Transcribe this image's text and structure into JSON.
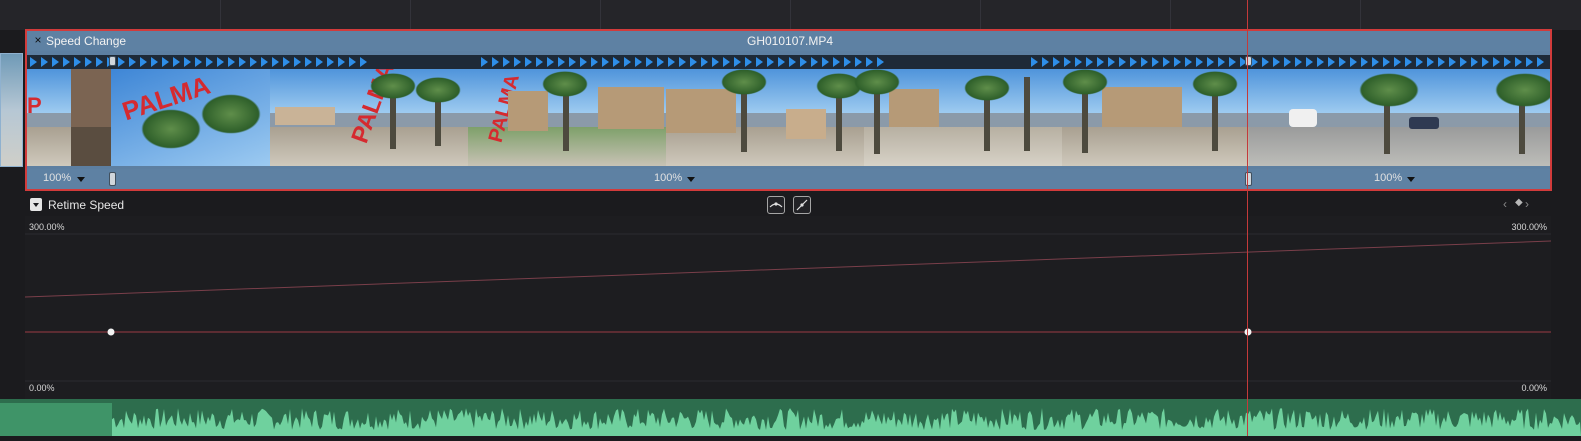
{
  "clip": {
    "effect_label": "Speed Change",
    "close_symbol": "×",
    "name": "GH010107.MP4",
    "segments": [
      {
        "speed_label": "100%"
      },
      {
        "speed_label": "100%"
      },
      {
        "speed_label": "100%"
      }
    ]
  },
  "retime": {
    "title": "Retime Speed",
    "max_left": "300.00%",
    "max_right": "300.00%",
    "min_left": "0.00%",
    "min_right": "0.00%"
  },
  "icons": {
    "collapse": "dropdown-toggle-icon",
    "curve_ease": "ease-curve-icon",
    "curve_linear": "linear-curve-icon",
    "nav_prev": "chevron-left-icon",
    "keyframe": "keyframe-diamond-icon",
    "nav_next": "chevron-right-icon",
    "speed_point": "speed-point-handle-icon",
    "arrows": "speed-direction-arrow-icon"
  },
  "colors": {
    "clip_header": "#5e81a3",
    "selection_border": "#d23b3b",
    "speed_arrows": "#2e8ee8",
    "playhead": "#c43a3a",
    "audio_waveform": "#6fd19e"
  }
}
